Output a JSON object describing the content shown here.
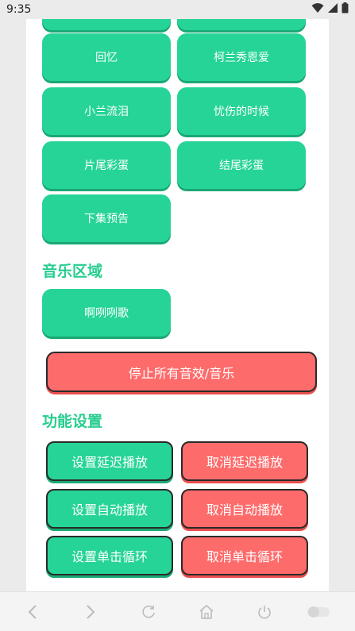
{
  "status_bar": {
    "time": "9:35",
    "icons": [
      "wifi-icon",
      "signal-icon",
      "battery-icon"
    ]
  },
  "sound_buttons": [
    {
      "label": "回忆"
    },
    {
      "label": "柯兰秀恩爱"
    },
    {
      "label": "小兰流泪"
    },
    {
      "label": "忧伤的时候"
    },
    {
      "label": "片尾彩蛋"
    },
    {
      "label": "结尾彩蛋"
    },
    {
      "label": "下集预告"
    }
  ],
  "music_section": {
    "title": "音乐区域",
    "buttons": [
      {
        "label": "啊咧咧歌"
      }
    ]
  },
  "stop_button": {
    "label": "停止所有音效/音乐"
  },
  "function_section": {
    "title": "功能设置",
    "buttons": [
      {
        "label": "设置延迟播放",
        "color": "#26d497"
      },
      {
        "label": "取消延迟播放",
        "color": "#fe6b6b"
      },
      {
        "label": "设置自动播放",
        "color": "#26d497"
      },
      {
        "label": "取消自动播放",
        "color": "#fe6b6b"
      },
      {
        "label": "设置单击循环",
        "color": "#26d497"
      },
      {
        "label": "取消单击循环",
        "color": "#fe6b6b"
      }
    ]
  },
  "colors": {
    "accent_green": "#26d497",
    "accent_red": "#fe6b6b",
    "section_title": "#28cd8f"
  },
  "nav_bar": {
    "icons": [
      "back-icon",
      "forward-icon",
      "refresh-icon",
      "home-icon",
      "power-icon",
      "toggle-icon"
    ]
  }
}
